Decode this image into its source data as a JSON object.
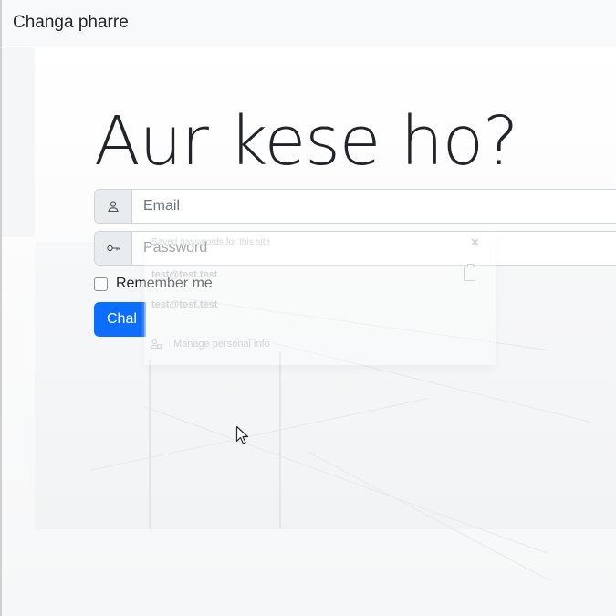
{
  "app": {
    "title": "Changa pharre"
  },
  "hero": {
    "heading": "Aur kese ho?"
  },
  "form": {
    "email": {
      "placeholder": "Email",
      "value": "",
      "icon": "user-icon"
    },
    "password": {
      "placeholder": "Password",
      "value": "",
      "icon": "key-icon"
    },
    "remember": {
      "label": "Remember me",
      "checked": false
    },
    "submit_label": "Chal"
  },
  "autofill_popup": {
    "header": "Saved passwords for this site",
    "items": [
      "test@test.test",
      "test@test.test"
    ],
    "manage_label": "Manage personal info"
  },
  "colors": {
    "primary": "#0d6efd",
    "navbar_bg": "#f8f9fa",
    "addon_bg": "#e9ecef",
    "border": "#ced4da"
  }
}
